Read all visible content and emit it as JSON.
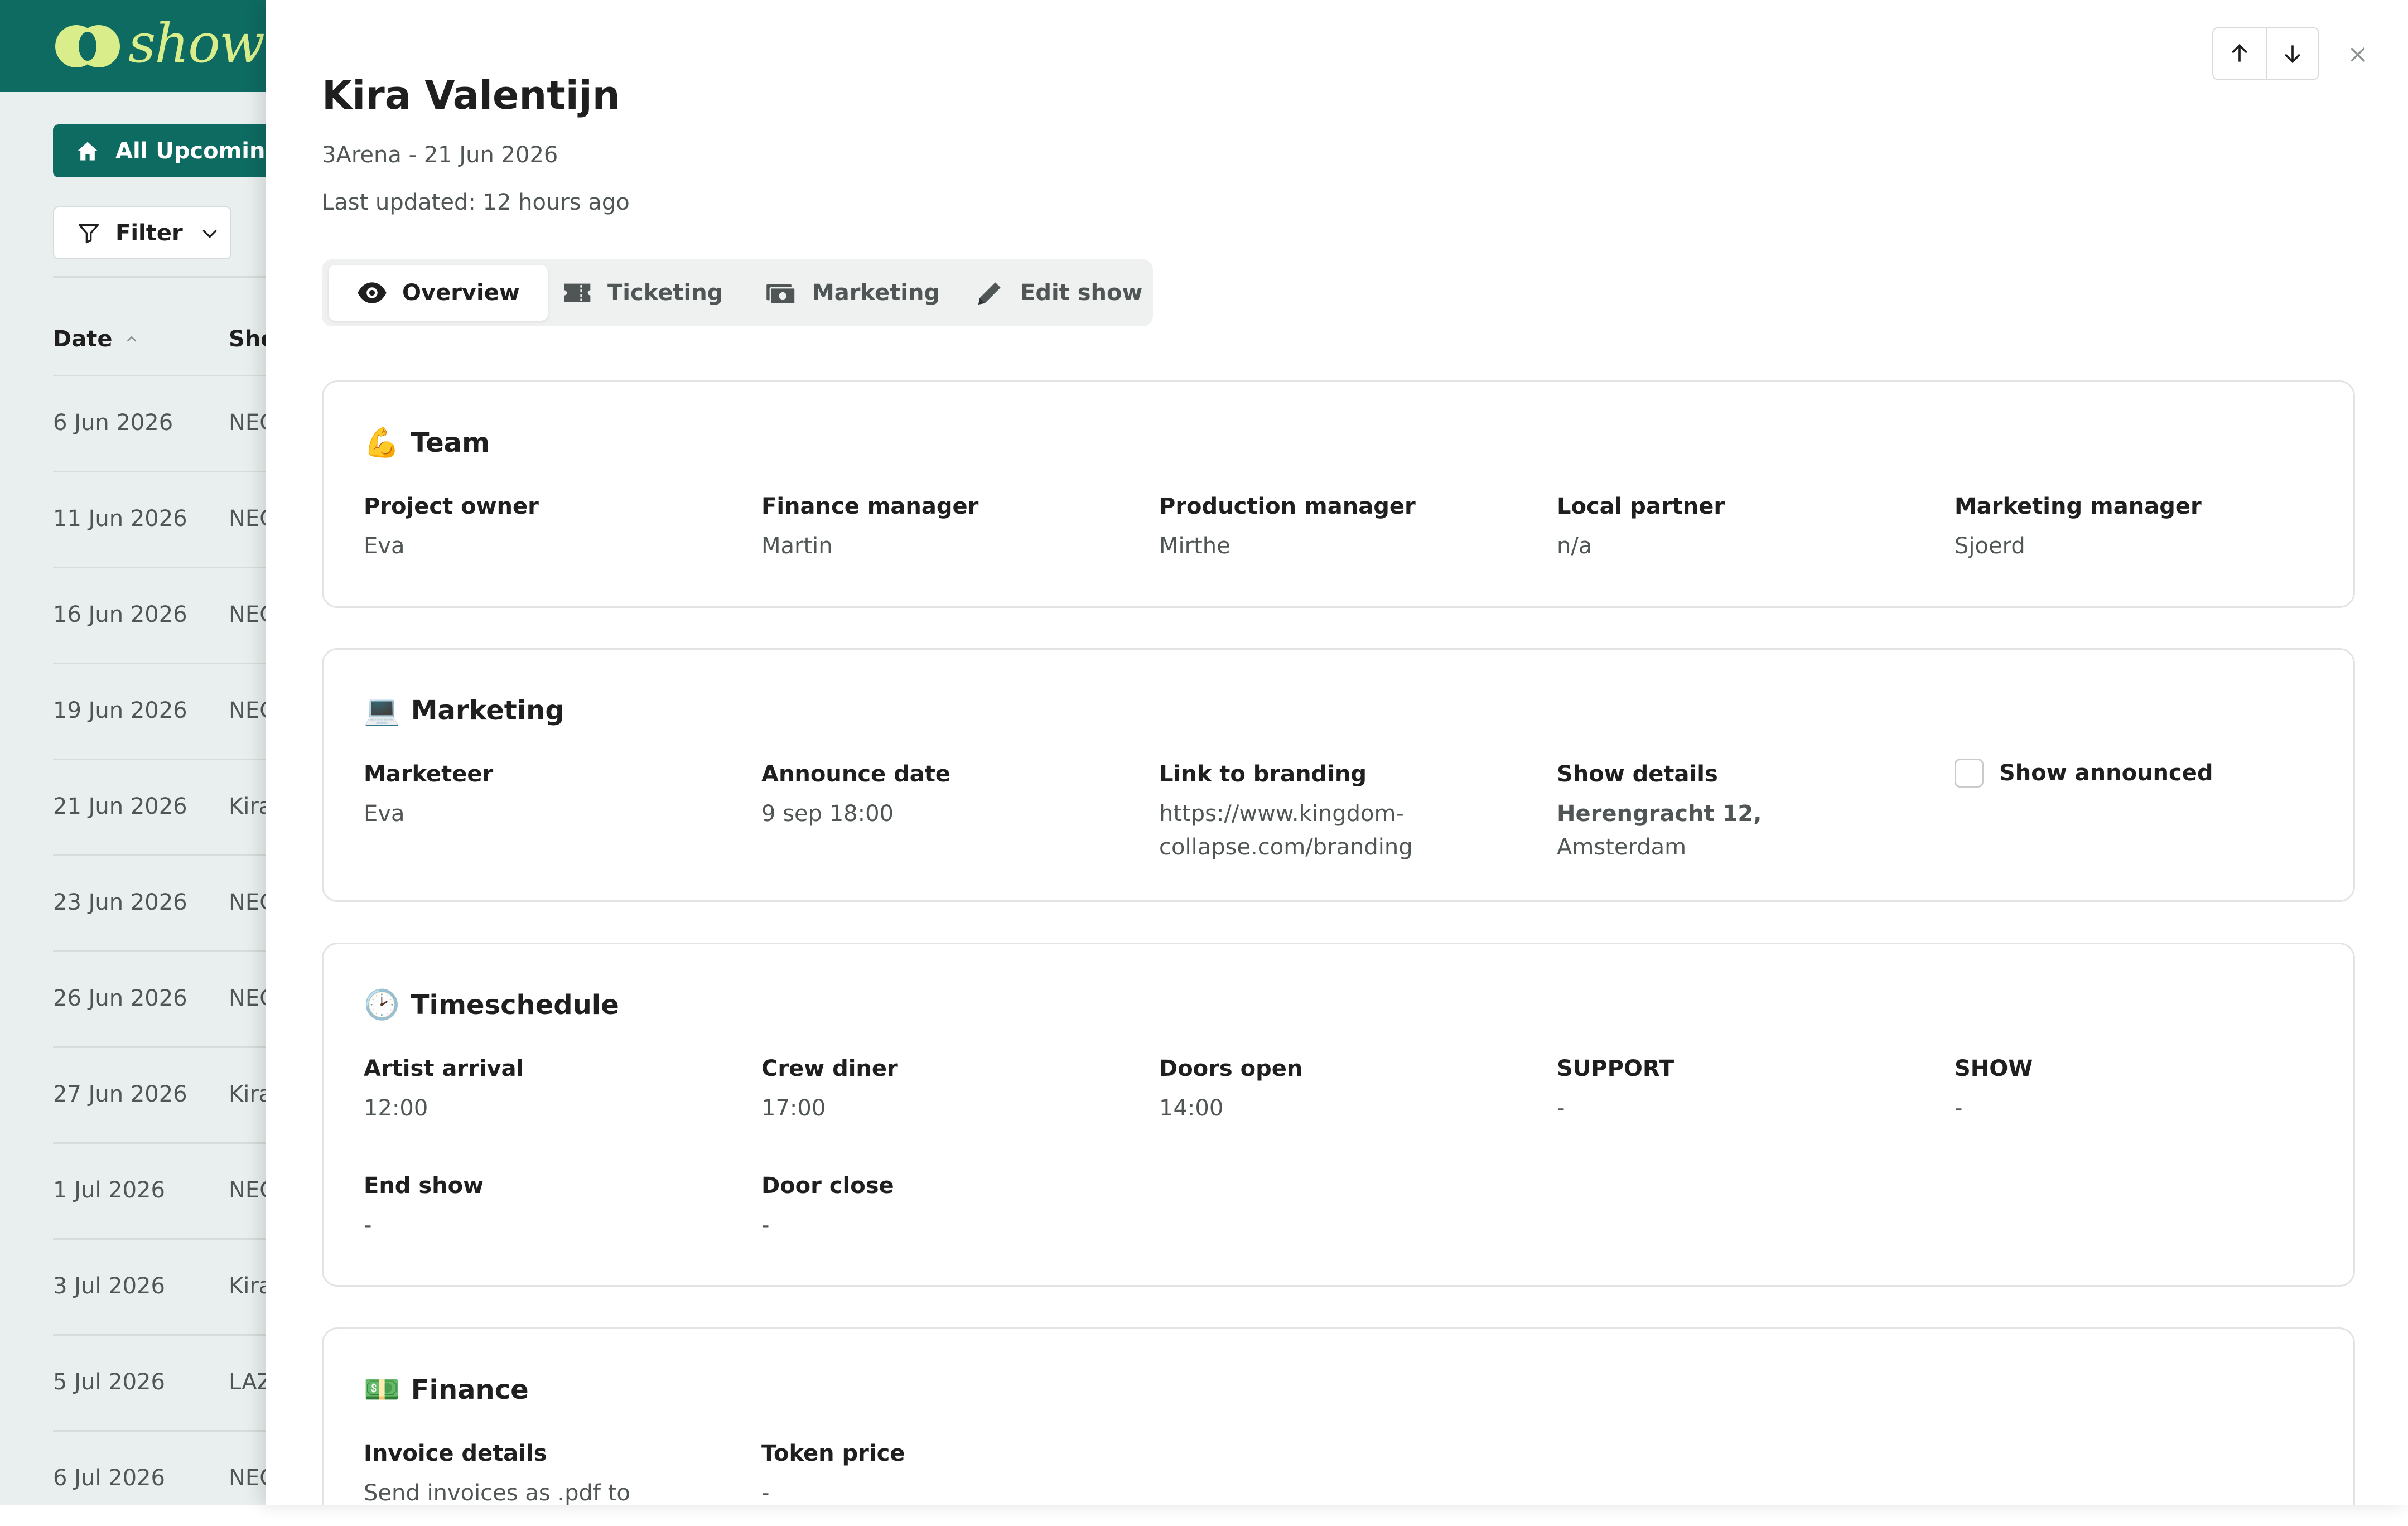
{
  "background": {
    "logo_text": "showt",
    "all_upcoming_label": "All Upcoming",
    "filter_label": "Filter",
    "columns": {
      "date": "Date",
      "show": "Sho"
    },
    "rows": [
      {
        "date": "6 Jun 2026",
        "show": "NEC"
      },
      {
        "date": "11 Jun 2026",
        "show": "NEC"
      },
      {
        "date": "16 Jun 2026",
        "show": "NEC"
      },
      {
        "date": "19 Jun 2026",
        "show": "NEC"
      },
      {
        "date": "21 Jun 2026",
        "show": "Kira"
      },
      {
        "date": "23 Jun 2026",
        "show": "NEC"
      },
      {
        "date": "26 Jun 2026",
        "show": "NEC"
      },
      {
        "date": "27 Jun 2026",
        "show": "Kira"
      },
      {
        "date": "1 Jul 2026",
        "show": "NEC"
      },
      {
        "date": "3 Jul 2026",
        "show": "Kira"
      },
      {
        "date": "5 Jul 2026",
        "show": "LAZ"
      },
      {
        "date": "6 Jul 2026",
        "show": "NEC"
      }
    ],
    "brand_color": "#0e6b62",
    "logo_color": "#d9ee8a"
  },
  "drawer": {
    "title": "Kira Valentijn",
    "subtitle": "3Arena - 21 Jun 2026",
    "last_updated": "Last updated: 12 hours ago",
    "tabs": [
      {
        "label": "Overview",
        "icon": "eye-icon",
        "active": true
      },
      {
        "label": "Ticketing",
        "icon": "ticket-icon",
        "active": false
      },
      {
        "label": "Marketing",
        "icon": "money-icon",
        "active": false
      },
      {
        "label": "Edit show",
        "icon": "pencil-icon",
        "active": false
      }
    ],
    "team": {
      "emoji": "💪",
      "title": "Team",
      "fields": [
        {
          "label": "Project owner",
          "value": "Eva"
        },
        {
          "label": "Finance manager",
          "value": "Martin"
        },
        {
          "label": "Production manager",
          "value": "Mirthe"
        },
        {
          "label": "Local partner",
          "value": "n/a"
        },
        {
          "label": "Marketing manager",
          "value": "Sjoerd"
        }
      ]
    },
    "marketing": {
      "emoji": "💻",
      "title": "Marketing",
      "fields": [
        {
          "label": "Marketeer",
          "value": "Eva"
        },
        {
          "label": "Announce date",
          "value": "9 sep 18:00"
        },
        {
          "label": "Link to branding",
          "value_line1": "https://www.kingdom-",
          "value_line2": "collapse.com/branding"
        },
        {
          "label": "Show details",
          "value_bold": "Herengracht 12,",
          "value_line2": "Amsterdam"
        }
      ],
      "checkbox_label": "Show announced",
      "checkbox_checked": false
    },
    "timeschedule": {
      "emoji": "🕑",
      "title": "Timeschedule",
      "fields": [
        {
          "label": "Artist arrival",
          "value": "12:00"
        },
        {
          "label": "Crew diner",
          "value": "17:00"
        },
        {
          "label": "Doors open",
          "value": "14:00"
        },
        {
          "label": "SUPPORT",
          "value": "-"
        },
        {
          "label": "SHOW",
          "value": "-"
        },
        {
          "label": "End show",
          "value": "-"
        },
        {
          "label": "Door close",
          "value": "-"
        }
      ]
    },
    "finance": {
      "emoji": "💵",
      "title": "Finance",
      "fields": [
        {
          "label": "Invoice details",
          "value": "Send invoices as .pdf to"
        },
        {
          "label": "Token price",
          "value": "-"
        }
      ]
    }
  }
}
